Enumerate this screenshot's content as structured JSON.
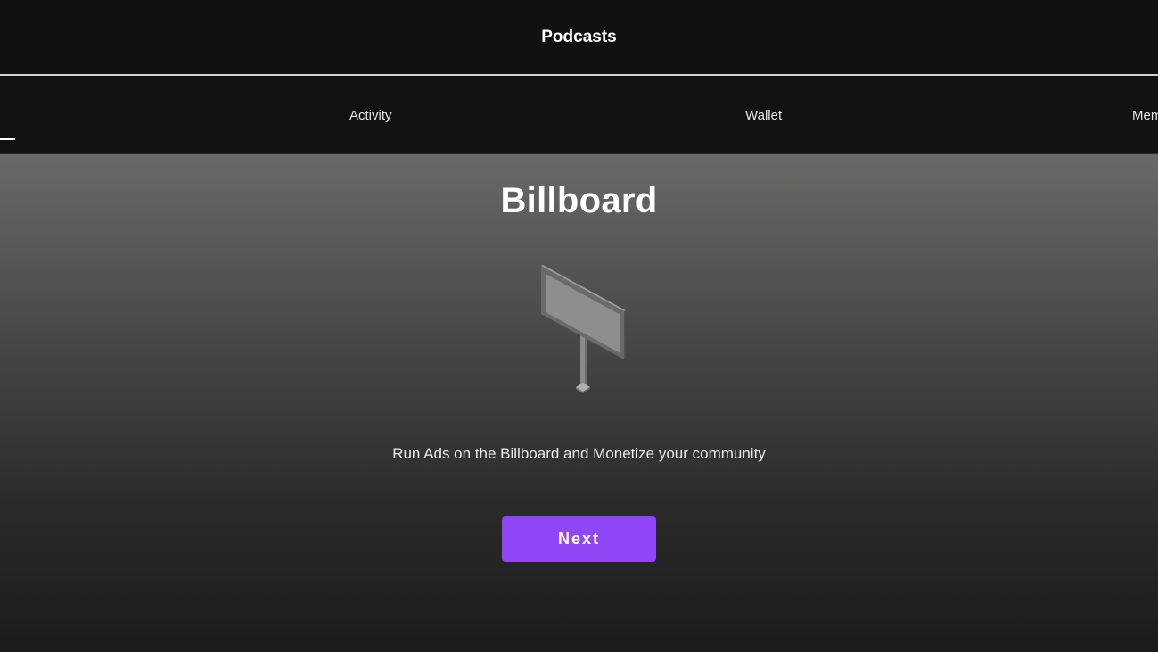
{
  "header": {
    "title": "Podcasts"
  },
  "tabs": [
    {
      "label": "Activity"
    },
    {
      "label": "Wallet"
    },
    {
      "label": "Mem"
    }
  ],
  "main": {
    "heading": "Billboard",
    "illustration_icon": "billboard-icon",
    "tagline": "Run Ads on the Billboard and Monetize your community",
    "next_label": "Next"
  },
  "colors": {
    "accent": "#9146f5",
    "header_bg": "#111111",
    "page_bg": "#121212"
  }
}
